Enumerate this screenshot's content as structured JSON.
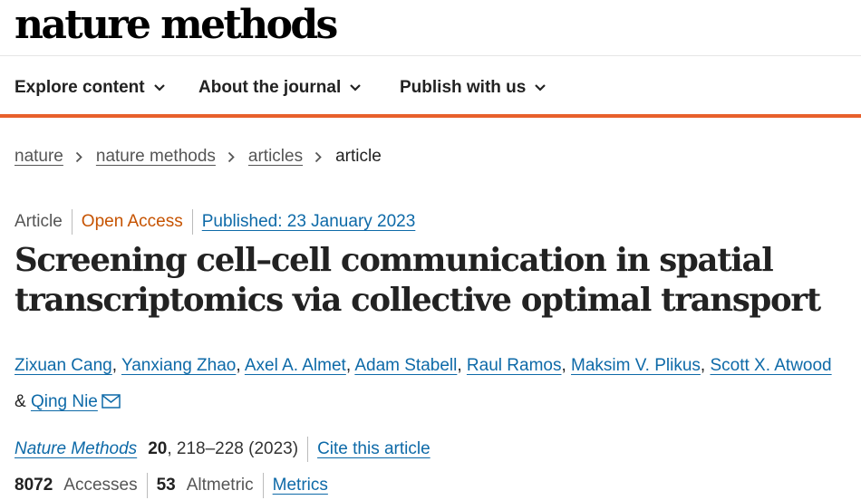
{
  "header": {
    "logo": "nature methods"
  },
  "nav": {
    "items": [
      {
        "label": "Explore content"
      },
      {
        "label": "About the journal"
      },
      {
        "label": "Publish with us"
      }
    ]
  },
  "breadcrumb": {
    "links": [
      "nature",
      "nature methods",
      "articles"
    ],
    "current": "article"
  },
  "article": {
    "type": "Article",
    "access": "Open Access",
    "published": "Published: 23 January 2023",
    "title": "Screening cell–cell communication in spatial transcriptomics via collective optimal transport",
    "authors": [
      "Zixuan Cang",
      "Yanxiang Zhao",
      "Axel A. Almet",
      "Adam Stabell",
      "Raul Ramos",
      "Maksim V. Plikus",
      "Scott X. Atwood",
      "Qing Nie"
    ],
    "author_separator": ", ",
    "author_last_joiner": "& ",
    "citation": {
      "journal": "Nature Methods",
      "volume": "20",
      "pages": ", 218–228 (2023)",
      "cite_label": "Cite this article"
    },
    "metrics": {
      "accesses_count": "8072",
      "accesses_label": "Accesses",
      "altmetric_count": "53",
      "altmetric_label": "Altmetric",
      "metrics_link": "Metrics"
    }
  },
  "colors": {
    "accent_orange": "#e8602c",
    "open_access": "#c65301",
    "link_blue": "#0e6aa8"
  },
  "icons": {
    "nav_chevron": "chevron-down-icon",
    "breadcrumb_separator": "chevron-right-icon",
    "corresponding_author": "mail-icon"
  }
}
